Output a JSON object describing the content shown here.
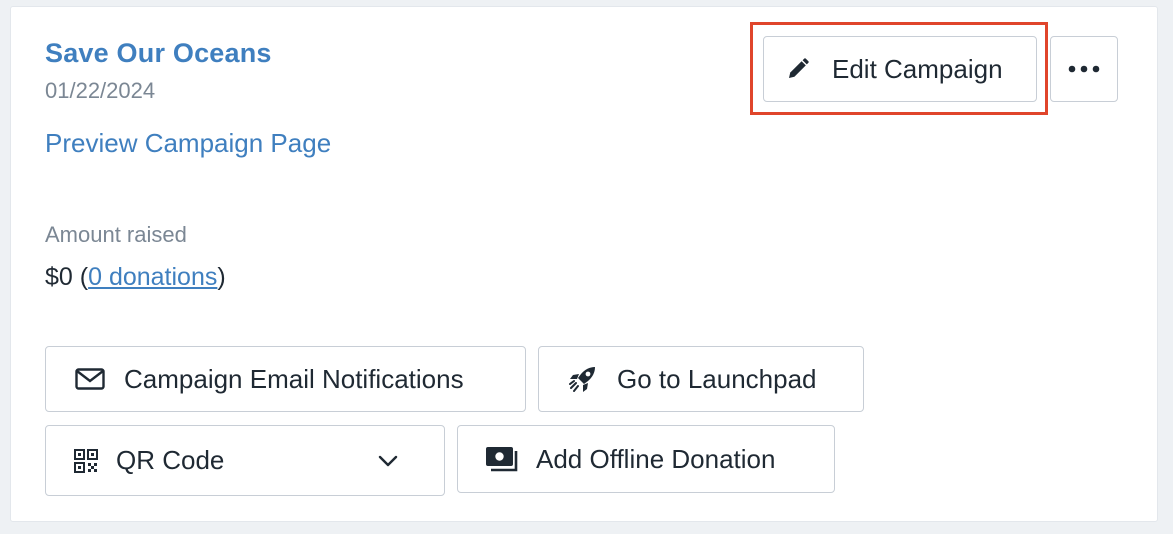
{
  "campaign": {
    "title": "Save Our Oceans",
    "date": "01/22/2024",
    "preview_link": "Preview Campaign Page"
  },
  "amount": {
    "label": "Amount raised",
    "value": "$0",
    "open_paren": "(",
    "donations_link": "0 donations",
    "close_paren": ")"
  },
  "actions": {
    "edit_label": "Edit Campaign",
    "edit_icon": "pencil-icon",
    "more_icon": "ellipsis-icon",
    "email_label": "Campaign Email Notifications",
    "email_icon": "envelope-icon",
    "launchpad_label": "Go to Launchpad",
    "launchpad_icon": "rocket-icon",
    "qr_label": "QR Code",
    "qr_icon": "qr-code-icon",
    "qr_chevron_icon": "chevron-down-icon",
    "offline_label": "Add Offline Donation",
    "offline_icon": "cash-icon"
  },
  "colors": {
    "link": "#3f7fbf",
    "highlight": "#e0452b",
    "text": "#1f2933",
    "muted": "#7b8794"
  }
}
